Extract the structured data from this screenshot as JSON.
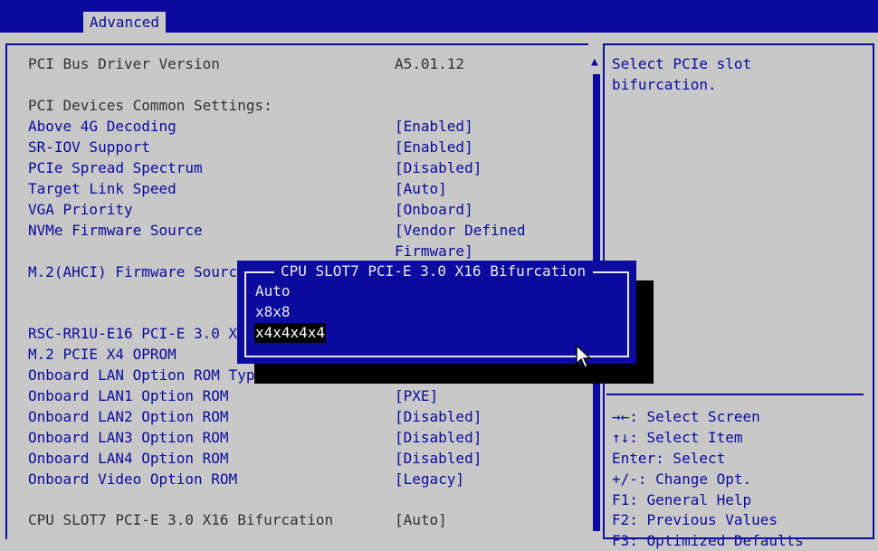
{
  "tabs": [
    {
      "label": "Advanced",
      "active": true
    }
  ],
  "info": {
    "pci_bus_driver_label": "PCI Bus Driver Version",
    "pci_bus_driver_value": "A5.01.12",
    "common_settings_heading": "PCI Devices Common Settings:"
  },
  "settings": [
    {
      "label": "Above 4G Decoding",
      "value": "[Enabled]"
    },
    {
      "label": "SR-IOV Support",
      "value": "[Enabled]"
    },
    {
      "label": "PCIe Spread Spectrum",
      "value": "[Disabled]"
    },
    {
      "label": "Target Link Speed",
      "value": "[Auto]"
    },
    {
      "label": "VGA Priority",
      "value": "[Onboard]"
    },
    {
      "label": "NVMe Firmware Source",
      "value": "[Vendor Defined",
      "value2": "Firmware]"
    },
    {
      "label": "M.2(AHCI) Firmware Sourc",
      "value": ""
    },
    {
      "label": "RSC-RR1U-E16 PCI-E 3.0 X",
      "value": ""
    },
    {
      "label": "M.2 PCIE X4 OPROM",
      "value": ""
    },
    {
      "label": "Onboard LAN Option ROM Typ",
      "value": ""
    },
    {
      "label": "Onboard LAN1 Option ROM",
      "value": "[PXE]"
    },
    {
      "label": "Onboard LAN2 Option ROM",
      "value": "[Disabled]"
    },
    {
      "label": "Onboard LAN3 Option ROM",
      "value": "[Disabled]"
    },
    {
      "label": "Onboard LAN4 Option ROM",
      "value": "[Disabled]"
    },
    {
      "label": "Onboard Video Option ROM",
      "value": "[Legacy]"
    }
  ],
  "selected_setting": {
    "label": "CPU SLOT7 PCI-E 3.0 X16 Bifurcation",
    "value": "[Auto]"
  },
  "help": {
    "description_line1": "Select PCIe slot",
    "description_line2": "bifurcation.",
    "keys": [
      "→←: Select Screen",
      "↑↓: Select Item",
      "Enter: Select",
      "+/-: Change Opt.",
      "F1: General Help",
      "F2: Previous Values",
      "F3: Optimized Defaults"
    ]
  },
  "popup": {
    "title": "CPU SLOT7 PCI-E 3.0 X16 Bifurcation",
    "options": [
      "Auto",
      "x8x8",
      "x4x4x4x4"
    ],
    "selected_index": 2
  },
  "colors": {
    "bios_blue": "#0b0b9e",
    "background": "#c8c8c8",
    "highlight": "#000000"
  }
}
